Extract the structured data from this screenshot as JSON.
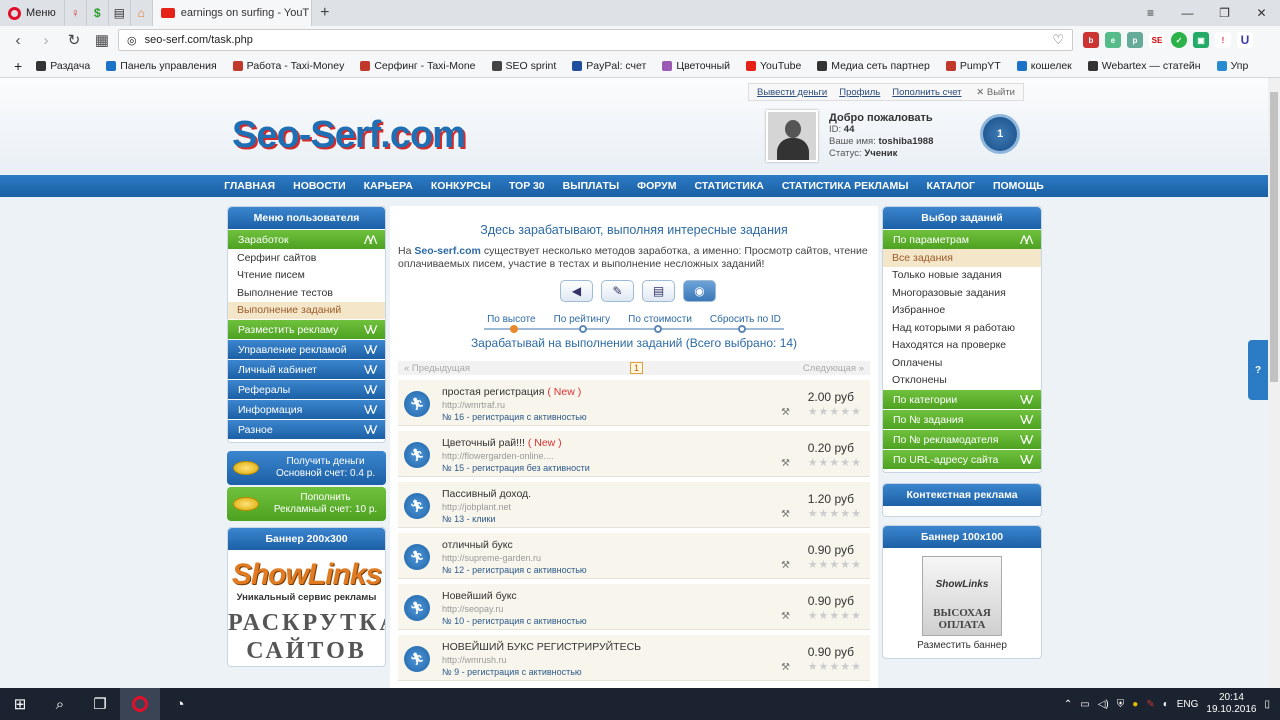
{
  "browser": {
    "menu_label": "Меню",
    "active_tab_title": "earnings on surfing - YouT",
    "url": "seo-serf.com/task.php",
    "bookmarks": [
      {
        "label": "Раздача",
        "color": "#333333"
      },
      {
        "label": "Панель управления",
        "color": "#1a73c7"
      },
      {
        "label": "Работа - Taxi-Money",
        "color": "#c0392b"
      },
      {
        "label": "Серфинг - Taxi-Mone",
        "color": "#c0392b"
      },
      {
        "label": "SEO sprint",
        "color": "#444444"
      },
      {
        "label": "PayPal: счет",
        "color": "#1f4e9c"
      },
      {
        "label": "Цветочный",
        "color": "#9b59b6"
      },
      {
        "label": "YouTube",
        "color": "#e62117"
      },
      {
        "label": "Медиа сеть партнер",
        "color": "#333333"
      },
      {
        "label": "PumpYT",
        "color": "#c0392b"
      },
      {
        "label": "кошелек",
        "color": "#1a73c7"
      },
      {
        "label": "Webartex — статейн",
        "color": "#333333"
      },
      {
        "label": "Упр",
        "color": "#2a8cd0"
      }
    ]
  },
  "site": {
    "top_links": {
      "withdraw": "Вывести деньги",
      "profile": "Профиль",
      "topup": "Пополнить счет",
      "exit": "Выйти"
    },
    "logo": "Seo-Serf.com",
    "user": {
      "welcome": "Добро пожаловать",
      "id_label": "ID:",
      "id": "44",
      "name_label": "Ваше имя:",
      "name": "toshiba1988",
      "status_label": "Статус:",
      "status": "Ученик",
      "level": "1"
    },
    "nav": [
      "ГЛАВНАЯ",
      "НОВОСТИ",
      "КАРЬЕРА",
      "КОНКУРСЫ",
      "TOP 30",
      "ВЫПЛАТЫ",
      "ФОРУМ",
      "СТАТИСТИКА",
      "СТАТИСТИКА РЕКЛАМЫ",
      "КАТАЛОГ",
      "ПОМОЩЬ"
    ]
  },
  "left": {
    "title": "Меню пользователя",
    "earn_label": "Заработок",
    "earn_items": [
      "Серфинг сайтов",
      "Чтение писем",
      "Выполнение тестов",
      "Выполнение заданий"
    ],
    "place_ad": "Разместить рекламу",
    "blue_rows": [
      "Управление рекламой",
      "Личный кабинет",
      "Рефералы",
      "Информация",
      "Разное"
    ],
    "btn_get_money": {
      "line1": "Получить деньги",
      "line2": "Основной счет: 0.4 р."
    },
    "btn_topup": {
      "line1": "Пополнить",
      "line2": "Рекламный счет: 10 р."
    },
    "banner_title": "Баннер 200x300",
    "banner_brand": "ShowLinks",
    "banner_sub": "Уникальный сервис рекламы",
    "banner_text": "РАСКРУТКА САЙТОВ"
  },
  "center": {
    "title": "Здесь зарабатывают, выполняя интересные задания",
    "desc_prefix": "На",
    "desc_site": "Seo-serf.com",
    "desc_rest": "существует несколько методов заработка, а именно: Просмотр сайтов, чтение оплачиваемых писем, участие в тестах и выполнение несложных заданий!",
    "sort_labels": [
      "По высоте",
      "По рейтингу",
      "По стоимости",
      "Сбросить по ID"
    ],
    "earn_heading": "Зарабатывай на выполнении заданий (Всего выбрано: 14)",
    "pager": {
      "prev": "« Предыдущая",
      "page": "1",
      "next": "Следующая »"
    },
    "tasks": [
      {
        "name": "простая регистрация",
        "new": "( New )",
        "url": "http://wmrtraf.ru",
        "meta": "№ 16 - регистрация с активностью",
        "price": "2.00 руб"
      },
      {
        "name": "Цветочный рай!!!",
        "new": "( New )",
        "url": "http://flowergarden-online....",
        "meta": "№ 15 - регистрация без активности",
        "price": "0.20 руб"
      },
      {
        "name": "Пассивный доход.",
        "new": "",
        "url": "http://jobplant.net",
        "meta": "№ 13 - клики",
        "price": "1.20 руб"
      },
      {
        "name": "отличный букс",
        "new": "",
        "url": "http://supreme-garden.ru",
        "meta": "№ 12 - регистрация с активностью",
        "price": "0.90 руб"
      },
      {
        "name": "Новейший букс",
        "new": "",
        "url": "http://seopay.ru",
        "meta": "№ 10 - регистрация с активностью",
        "price": "0.90 руб"
      },
      {
        "name": "НОВЕЙШИЙ БУКС РЕГИСТРИРУЙТЕСЬ",
        "new": "",
        "url": "http://wmrush.ru",
        "meta": "№ 9 - регистрация с активностью",
        "price": "0.90 руб"
      }
    ]
  },
  "right": {
    "title": "Выбор заданий",
    "params_label": "По параметрам",
    "params_items": [
      "Все задания",
      "Только новые задания",
      "Многоразовые задания",
      "Избранное",
      "Над которыми я работаю",
      "Находятся на проверке",
      "Оплачены",
      "Отклонены"
    ],
    "green_rows": [
      "По категории",
      "По № задания",
      "По № рекламодателя",
      "По URL-адресу сайта"
    ],
    "context_ad": "Контекстная реклама",
    "banner_title": "Баннер 100x100",
    "banner_brand": "ShowLinks",
    "banner_text1": "ВЫСОХАЯ",
    "banner_text2": "ОПЛАТА",
    "banner_caption": "Разместить баннер",
    "side_tab": "?"
  },
  "taskbar": {
    "lang": "ENG",
    "time": "20:14",
    "date": "19.10.2016"
  }
}
